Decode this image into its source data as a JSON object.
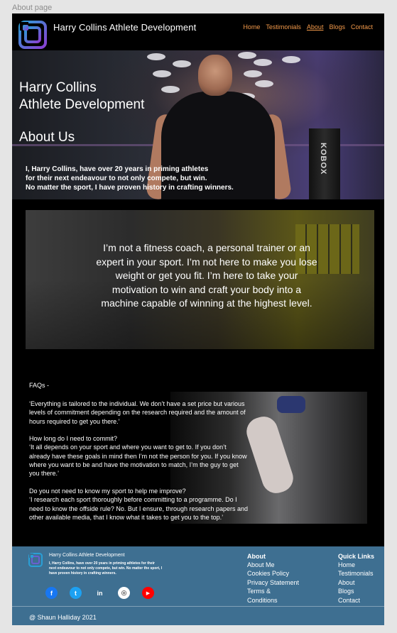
{
  "frame_label": "About page",
  "header": {
    "brand": "Harry Collins Athlete Development",
    "nav": [
      "Home",
      "Testimonials",
      "About",
      "Blogs",
      "Contact"
    ],
    "active_index": 2,
    "accent": "#f2994a"
  },
  "hero": {
    "title_line1": "Harry Collins",
    "title_line2": "Athlete Development",
    "subtitle": "About Us",
    "desc": [
      "I, Harry Collins, have over 20 years in priming athletes",
      "for their next endeavour to not only compete, but win.",
      "No matter the sport, I have proven history in crafting winners."
    ],
    "bag_text": "KOBOX"
  },
  "quote": {
    "lines": [
      "I’m not a fitness coach, a personal trainer or an",
      "expert in your sport. I’m not here to make you lose",
      "weight or get you fit. I’m here to take your",
      "motivation to win and craft your body into a",
      "machine capable of winning at the highest level."
    ]
  },
  "faq": {
    "title": "FAQs -",
    "blocks": [
      [
        "‘Everything is tailored to the individual. We don’t have a set price but various",
        "levels of commitment depending on the research required and the amount of",
        "hours required to get you there.’"
      ],
      [
        "How long do I need to commit?",
        "‘It all depends on your sport and where you want to get to. If you don’t",
        "already have these goals in mind then I’m not the person for you. If you know",
        "where you want to be and have the motivation to match, I’m the guy to get",
        "you there.’"
      ],
      [
        "Do you not need to know my sport to help me improve?",
        "‘I research each sport thoroughly before committing to a programme. Do I",
        "need to know the offside rule? No. But I ensure, through research papers and",
        "other available media, that I know what it takes to get you to the top.’"
      ]
    ]
  },
  "footer": {
    "brand": "Harry Collins Athlete Development",
    "desc": "I, Harry Collins, have over 20 years in priming athletes for their next endeavour to not only compete, but win. No matter the sport, I have proven history in crafting winners.",
    "socials": [
      {
        "icon": "facebook-icon",
        "glyph": "f",
        "bg": "#1877f2",
        "fg": "#ffffff"
      },
      {
        "icon": "twitter-icon",
        "glyph": "t",
        "bg": "#1da1f2",
        "fg": "#ffffff"
      },
      {
        "icon": "linkedin-icon",
        "glyph": "in",
        "bg": "#3e6f91",
        "fg": "#ffffff"
      },
      {
        "icon": "instagram-icon",
        "glyph": "◎",
        "bg": "#ffffff",
        "fg": "#000000"
      },
      {
        "icon": "youtube-icon",
        "glyph": "▶",
        "bg": "#ff0000",
        "fg": "#ffffff"
      }
    ],
    "about_heading": "About",
    "about_links": [
      "About Me",
      "Cookies Policy",
      "Privacy Statement",
      "Terms &",
      "Conditions"
    ],
    "quick_heading": "Quick Links",
    "quick_links": [
      "Home",
      "Testimonials",
      "About",
      "Blogs",
      "Contact"
    ],
    "copyright": "@ Shaun Halliday 2021",
    "bg": "#3e6f91"
  }
}
